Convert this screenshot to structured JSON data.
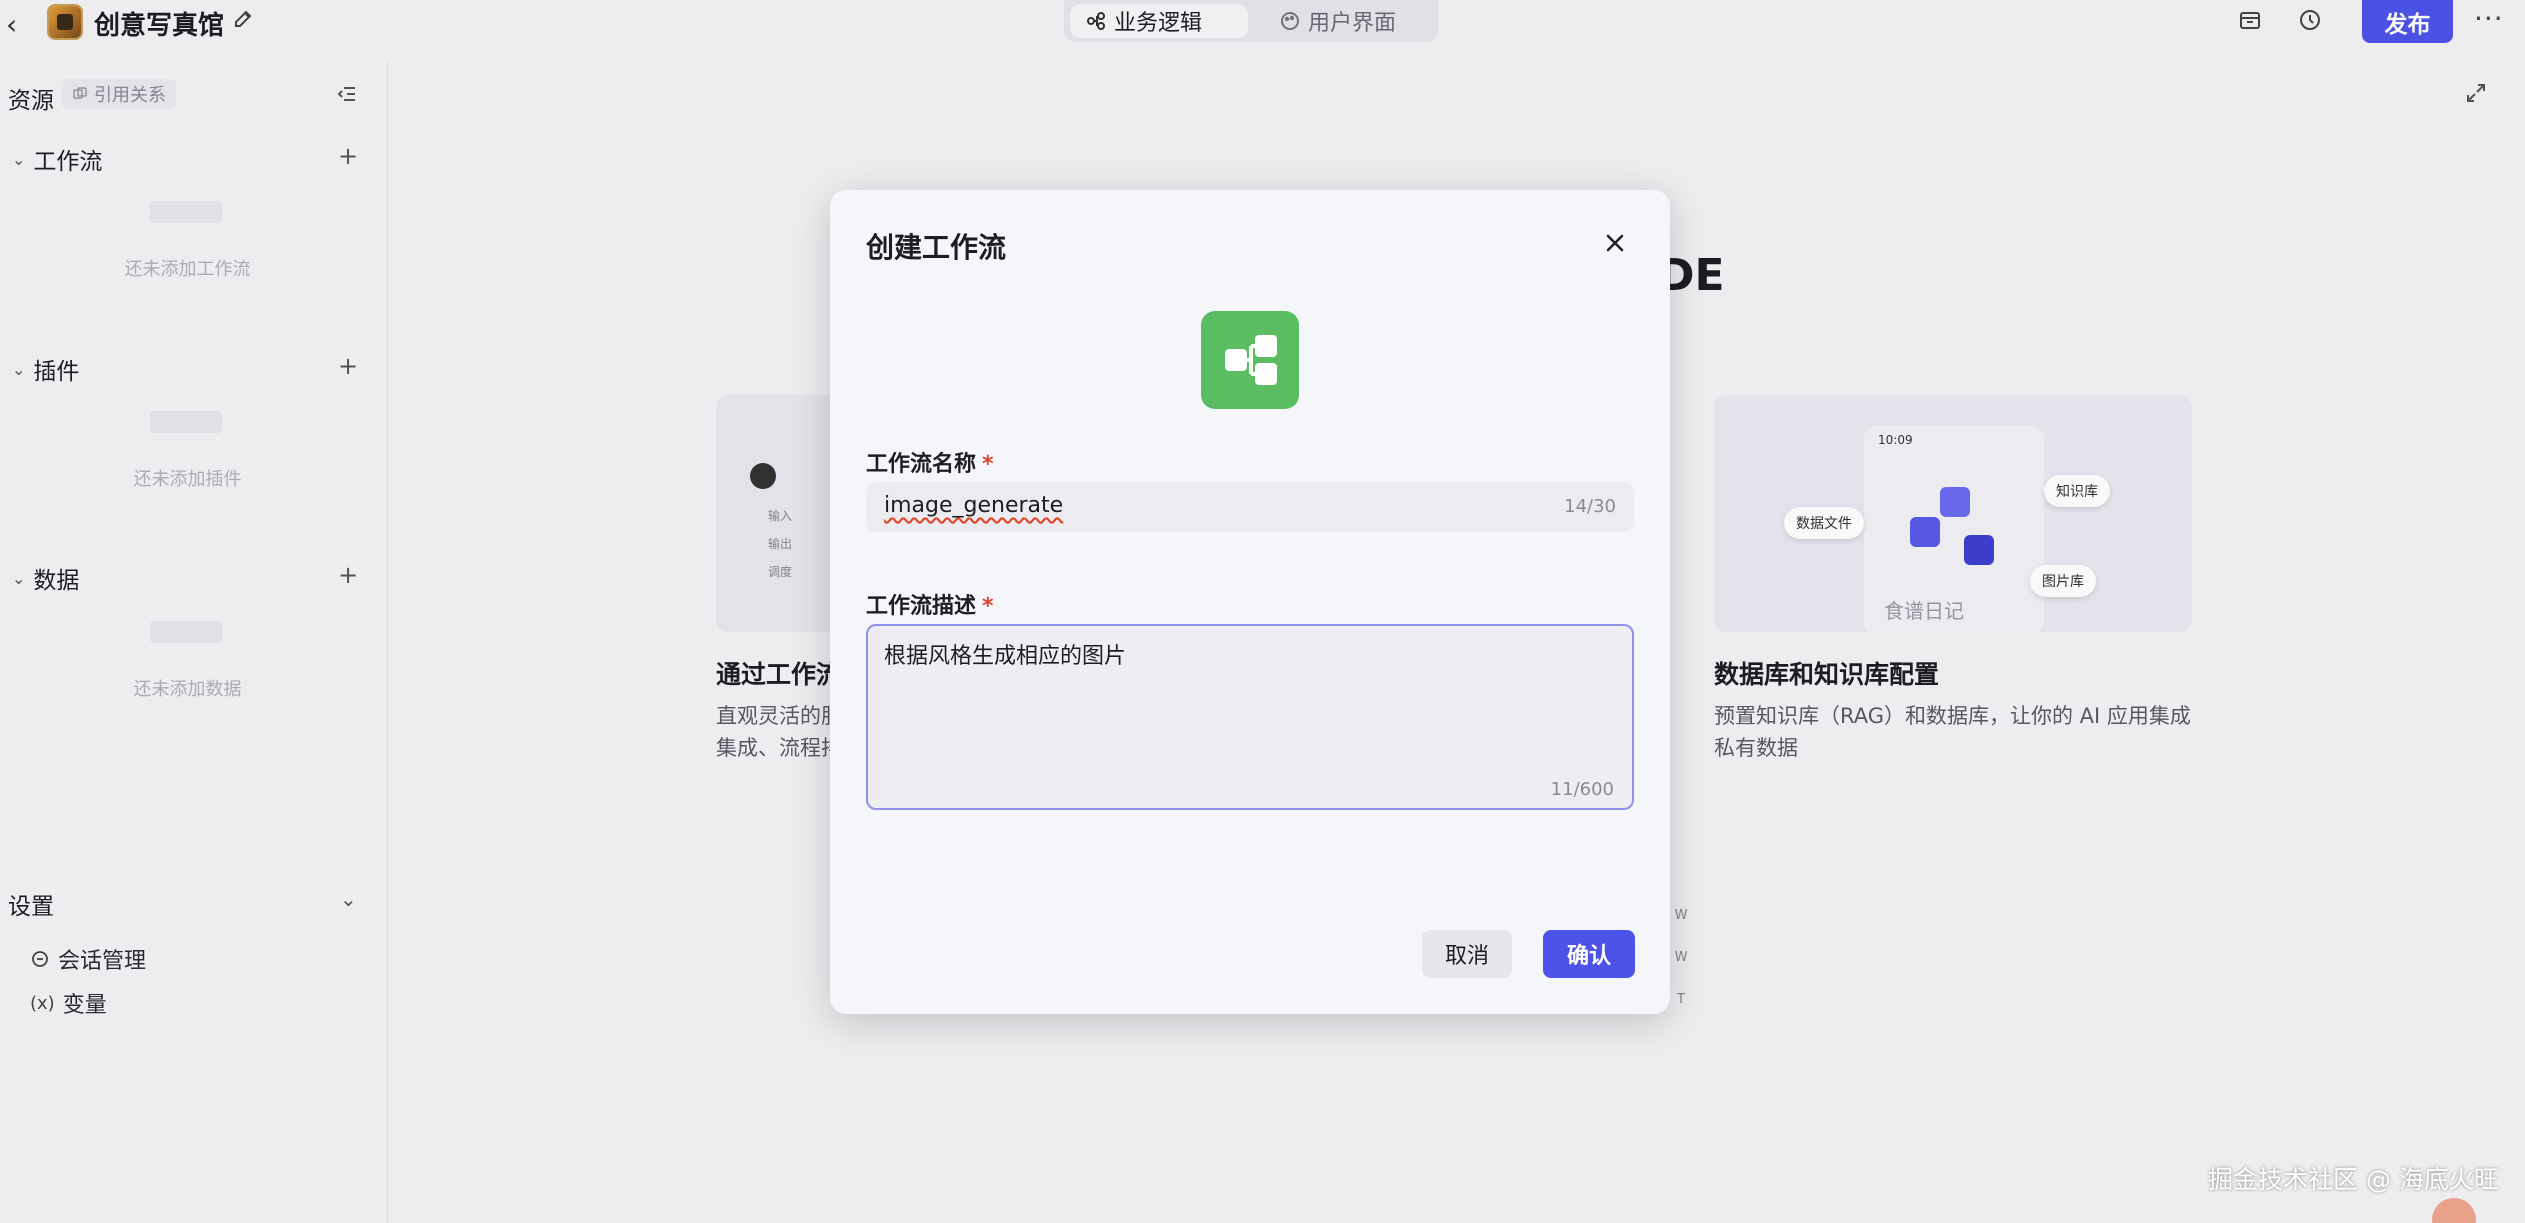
{
  "topbar": {
    "app_title": "创意写真馆",
    "tabs": [
      {
        "label": "业务逻辑",
        "icon": "workflow-icon",
        "active": true
      },
      {
        "label": "用户界面",
        "icon": "palette-icon",
        "active": false
      }
    ],
    "publish_label": "发布",
    "more_label": "···"
  },
  "sidebar": {
    "resources_label": "资源",
    "references_label": "引用关系",
    "sections": [
      {
        "label": "工作流",
        "empty_text": "还未添加工作流"
      },
      {
        "label": "插件",
        "empty_text": "还未添加插件"
      },
      {
        "label": "数据",
        "empty_text": "还未添加数据"
      }
    ],
    "settings_label": "设置",
    "settings_items": [
      {
        "label": "会话管理",
        "icon": "conversation-icon"
      },
      {
        "label": "变量",
        "icon": "variable-icon"
      }
    ]
  },
  "background": {
    "heading_fragment": "DE",
    "card_left": {
      "title": "通过工作流",
      "desc_line1": "直观灵活的服",
      "desc_line2": "集成、流程排",
      "labels": [
        "输入",
        "输出",
        "调度"
      ]
    },
    "card_right": {
      "title": "数据库和知识库配置",
      "desc_line1": "预置知识库（RAG）和数据库，让你的 AI 应用集成",
      "desc_line2": "私有数据",
      "phone_time": "10:09",
      "phone_caption": "食谱日记",
      "pills": [
        "数据文件",
        "知识库",
        "图片库"
      ]
    },
    "kbd_hints": [
      "W",
      "W",
      "T"
    ]
  },
  "dialog": {
    "title": "创建工作流",
    "name_label": "工作流名称",
    "name_value": "image_generate",
    "name_count": "14/30",
    "desc_label": "工作流描述",
    "desc_value": "根据风格生成相应的图片",
    "desc_count": "11/600",
    "required_mark": "*",
    "cancel_label": "取消",
    "confirm_label": "确认",
    "accent_color": "#4d53e8",
    "icon_color": "#5bbd61"
  },
  "watermark": "掘金技术社区 @ 海底火旺"
}
